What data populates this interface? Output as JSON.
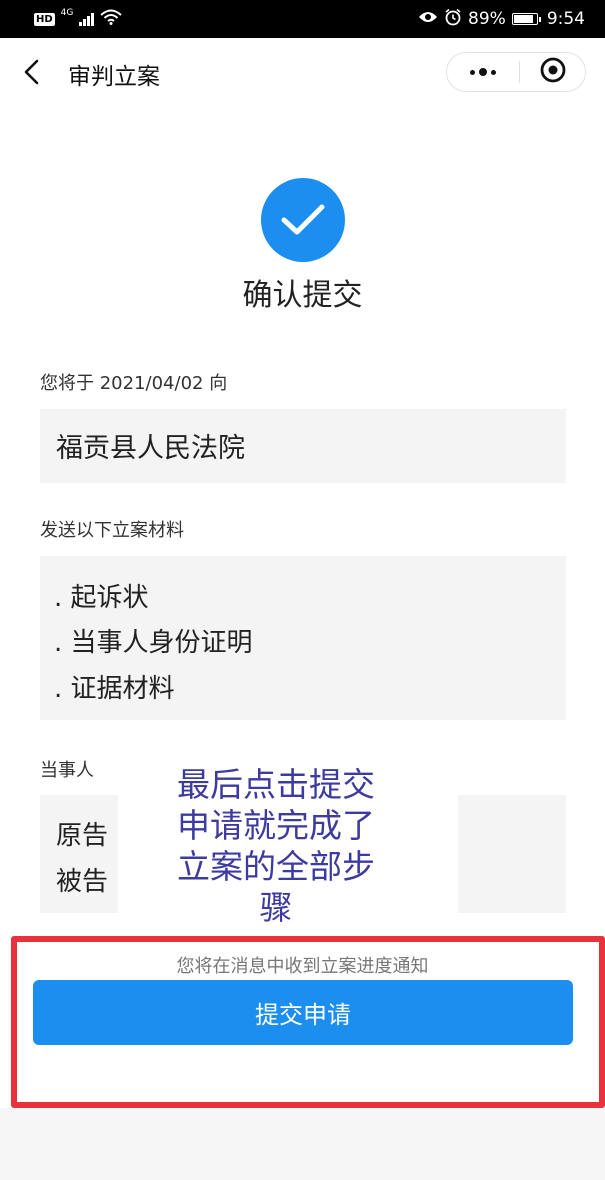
{
  "status_bar": {
    "hd": "HD",
    "network": "4G",
    "battery_percent": "89%",
    "battery_level": 0.89,
    "time": "9:54",
    "icons": [
      "signal-icon",
      "wifi-icon",
      "eye-icon",
      "alarm-icon",
      "battery-icon"
    ]
  },
  "nav": {
    "title": "审判立案"
  },
  "confirm": {
    "title": "确认提交",
    "date_line": "您将于 2021/04/02 向",
    "court": "福贡县人民法院",
    "materials_label": "发送以下立案材料",
    "materials": [
      ". 起诉状",
      ". 当事人身份证明",
      ". 证据材料"
    ],
    "parties_label": "当事人",
    "parties": [
      "原告",
      "被告"
    ]
  },
  "annotation": {
    "lines": [
      "最后点击提交",
      "申请就完成了",
      "立案的全部步",
      "骤"
    ]
  },
  "footer": {
    "notice": "您将在消息中收到立案进度通知",
    "submit_label": "提交申请"
  },
  "colors": {
    "accent": "#1b8ef0",
    "annotation_text": "#3d3aa0",
    "highlight": "#e8323b"
  }
}
